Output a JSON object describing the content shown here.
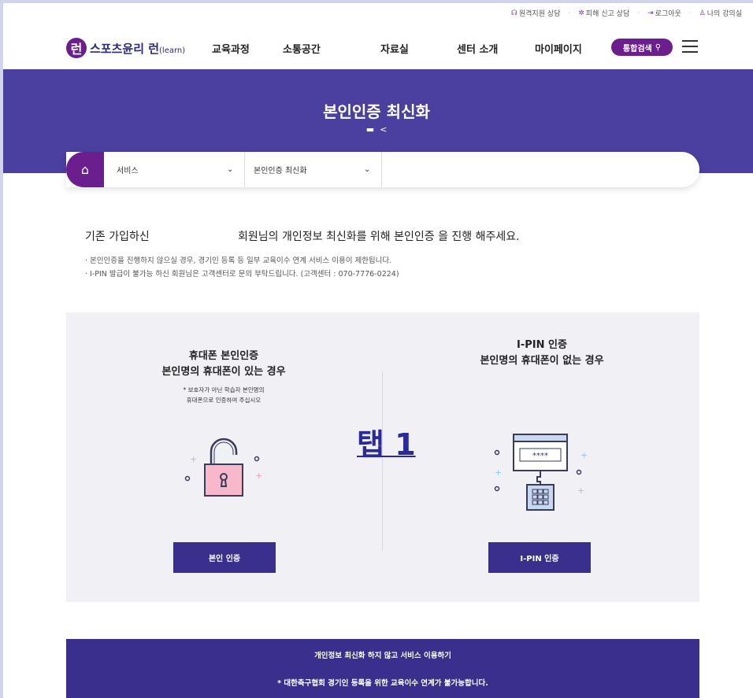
{
  "util_nav": {
    "remote": "원격지원 상담",
    "report": "피해 신고 상담",
    "logout": "로그아웃",
    "myroom": "나의 강의실"
  },
  "logo": {
    "mark": "런",
    "name": "스포츠윤리 런",
    "suffix": "(learn)"
  },
  "gnb": [
    "교육과정",
    "소통공간",
    "자료실",
    "센터 소개",
    "마이페이지"
  ],
  "search": {
    "label": "통합검색"
  },
  "banner": {
    "title": "본인인증 최신화"
  },
  "location": {
    "sel1": "서비스",
    "sel2": "본인인증 최신화"
  },
  "intro": {
    "part1": "기존 가입하신",
    "part2": "회원님의 개인정보 최신화를 위해 본인인증 을 진행 해주세요."
  },
  "notes": [
    "· 본인인증을 진행하지 않으실 경우, 경기인 등록 등 일부 교육이수 연계 서비스 이용이 제한됩니다.",
    "· I-PIN 발급이 불가능 하신 회원님은 고객센터로 문의 부탁드립니다. (고객센터 : 070-7776-0224)"
  ],
  "phone": {
    "title": "휴대폰 본인인증",
    "subtitle": "본인명의 휴대폰이 있는 경우",
    "note1": "* 보호자가 아닌 학습자 본인명의",
    "note2": "휴대폰으로 인증하여 주십시오",
    "button": "본인 인증"
  },
  "ipin": {
    "title": "I-PIN 인증",
    "subtitle": "본인명의 휴대폰이 없는 경우",
    "pw": "****",
    "button": "I-PIN 인증"
  },
  "overlay": {
    "label": "탭 1"
  },
  "bottom": {
    "line1": "개인정보 최신화 하지 않고 서비스 이용하기",
    "line2": "* 대한축구협회 경기인 등록을 위한 교육이수 연계가 불가능합니다."
  },
  "colors": {
    "brand": "#6b1f8f",
    "banner": "#4b3fa0",
    "button": "#3a2f8c"
  }
}
